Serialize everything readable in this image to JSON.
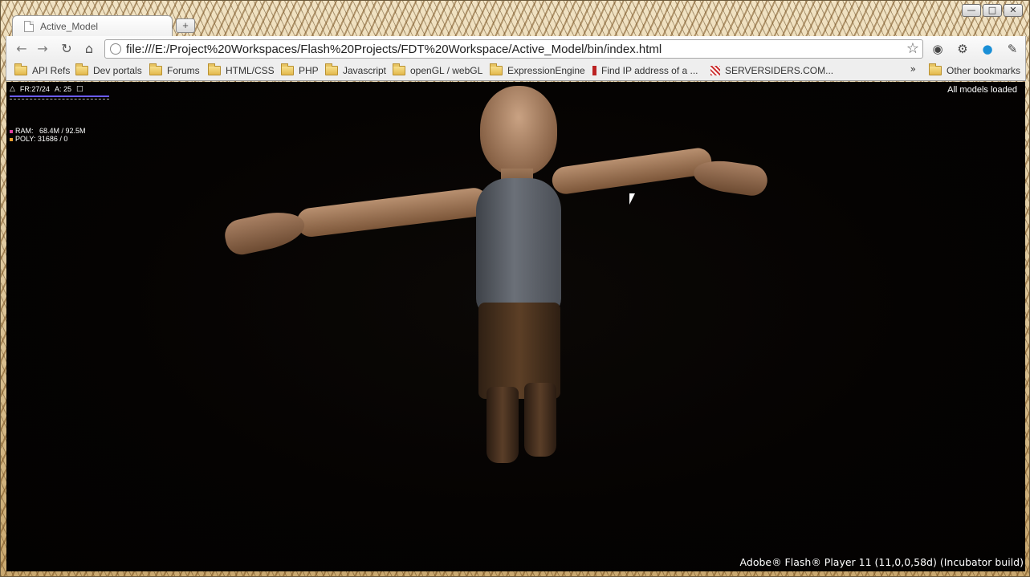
{
  "browser": {
    "tab": {
      "title": "Active_Model"
    },
    "window_controls": {
      "minimize": "—",
      "maximize": "□",
      "close": "✕"
    },
    "address_bar": {
      "url": "file:///E:/Project%20Workspaces/Flash%20Projects/FDT%20Workspace/Active_Model/bin/index.html"
    },
    "bookmarks": [
      {
        "label": "API Refs",
        "icon": "folder-icon"
      },
      {
        "label": "Dev portals",
        "icon": "folder-icon"
      },
      {
        "label": "Forums",
        "icon": "folder-icon"
      },
      {
        "label": "HTML/CSS",
        "icon": "folder-icon"
      },
      {
        "label": "PHP",
        "icon": "folder-icon"
      },
      {
        "label": "Javascript",
        "icon": "folder-icon"
      },
      {
        "label": "openGL / webGL",
        "icon": "folder-icon"
      },
      {
        "label": "ExpressionEngine",
        "icon": "folder-icon"
      },
      {
        "label": "Find IP address of a ...",
        "icon": "favicon"
      },
      {
        "label": "SERVERSIDERS.COM...",
        "icon": "favicon"
      }
    ],
    "overflow": "»",
    "other_bookmarks": "Other bookmarks"
  },
  "flash": {
    "stats": {
      "fr": "FR:27/24",
      "a": "A: 25",
      "ram_label": "RAM:",
      "ram_value": "68.4M / 92.5M",
      "poly_label": "POLY:",
      "poly_value": "31686 / 0"
    },
    "status": "All models loaded",
    "player_version": "Adobe® Flash® Player 11 (11,0,0,58d) (Incubator build)"
  },
  "colors": {
    "stage_bg": "#050302",
    "stats_line": "#6b5cff",
    "ram_marker": "#e040a0",
    "poly_marker": "#f0a030"
  }
}
